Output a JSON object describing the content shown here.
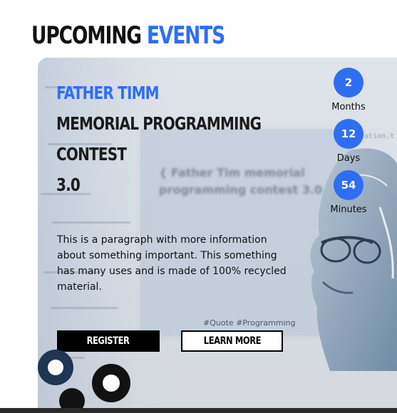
{
  "section": {
    "title_plain": "Upcoming",
    "title_accent": "Events"
  },
  "event": {
    "title_accent": "Father Timm",
    "title_lines": [
      "Memorial Programming",
      "Contest",
      "3.0"
    ],
    "description": "This is a paragraph with more information about something important. This something has many uses and is made of 100% recycled material.",
    "background_quote": "{ Father Tim memorial programming contest 3.0 }",
    "background_tags": "#Quote #Programming",
    "background_code_snip": "vation.t"
  },
  "countdown": [
    {
      "value": "2",
      "label": "Months"
    },
    {
      "value": "12",
      "label": "Days"
    },
    {
      "value": "54",
      "label": "Minutes"
    }
  ],
  "buttons": {
    "register": "Register",
    "learn_more": "Learn More"
  },
  "colors": {
    "accent": "#2f6ef2",
    "text": "#111111",
    "button_dark": "#000000"
  }
}
